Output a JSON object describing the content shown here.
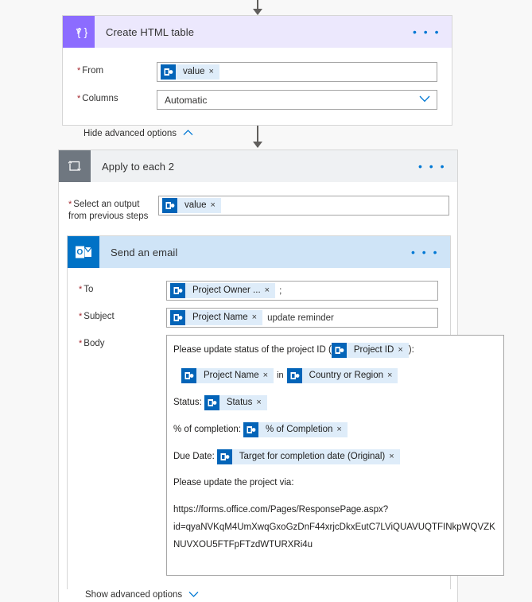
{
  "steps": {
    "create_html_table": {
      "title": "Create HTML table",
      "icon": "html-table-icon",
      "menu": "• • •",
      "fields": {
        "from_label": "From",
        "from_token": "value",
        "columns_label": "Columns",
        "columns_value": "Automatic"
      },
      "advanced_link": "Hide advanced options"
    },
    "apply_to_each": {
      "title": "Apply to each 2",
      "icon": "loop-icon",
      "menu": "• • •",
      "fields": {
        "output_label": "Select an output\nfrom previous steps",
        "output_token": "value"
      }
    },
    "send_an_email": {
      "title": "Send an email",
      "icon": "outlook-icon",
      "menu": "• • •",
      "fields": {
        "to_label": "To",
        "to_token": "Project Owner ...",
        "to_suffix": ";",
        "subject_label": "Subject",
        "subject_token": "Project Name",
        "subject_text": "update reminder",
        "body_label": "Body"
      },
      "body": {
        "line1_prefix": "Please update status of the project ID (",
        "line1_token": "Project ID",
        "line1_suffix": "):",
        "line2_token_a": "Project Name",
        "line2_mid": "in",
        "line2_token_b": "Country or Region",
        "line3_prefix": "Status:",
        "line3_token": "Status",
        "line4_prefix": "% of completion:",
        "line4_token": "% of Completion",
        "line5_prefix": "Due Date:",
        "line5_token": "Target for completion date (Original)",
        "line6": "Please update the project via:",
        "url_line1": "https://forms.office.com/Pages/ResponsePage.aspx?",
        "url_line2": "id=qyaNVKqM4UmXwqGxoGzDnF44xrjcDkxEutC7LViQUAVUQTFINkpWQVZK",
        "url_line3": "NUVXOU5FTFpFTzdWTURXRi4u"
      },
      "advanced_link": "Show advanced options"
    }
  },
  "token_close_glyph": "×",
  "colors": {
    "accent": "#0078d4",
    "html_table_header": "#ece8fd",
    "html_table_icon": "#8c6cff",
    "loop_header": "#eff1f3",
    "loop_icon": "#6f7780",
    "mail_header": "#cfe4f7",
    "mail_icon": "#0072c6",
    "token_icon": "#0364b8",
    "token_pill": "#deecf9",
    "required_asterisk": "#a4262c",
    "connector": "#605e5c",
    "canvas": "#f8f8f8"
  }
}
